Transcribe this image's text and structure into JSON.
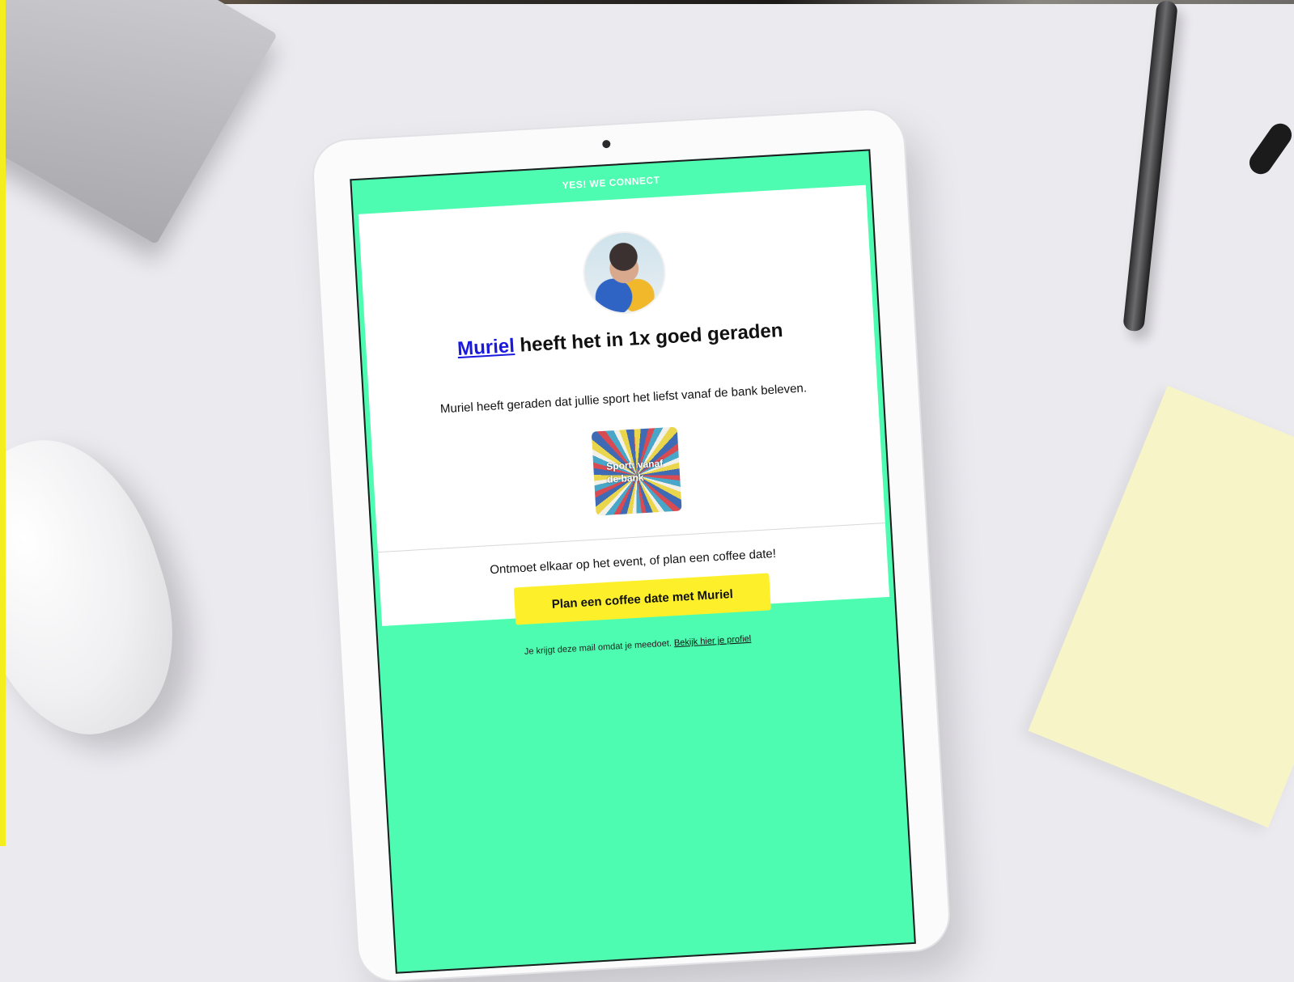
{
  "email": {
    "brand_header": "YES! WE CONNECT",
    "headline_name": "Muriel",
    "headline_rest": " heeft het in 1x goed geraden",
    "subline": "Muriel heeft geraden dat jullie sport het liefst vanaf de bank beleven.",
    "card_label": "Sport: vanaf de bank",
    "cta_text": "Ontmoet elkaar op het event, of plan een coffee date!",
    "cta_button": "Plan een coffee date met Muriel",
    "footer_text": "Je krijgt deze mail omdat je meedoet. ",
    "footer_link": "Bekijk hier je profiel"
  },
  "colors": {
    "brand_green": "#4dfcb0",
    "cta_yellow": "#fdf02a",
    "link_blue": "#1a1adf"
  }
}
